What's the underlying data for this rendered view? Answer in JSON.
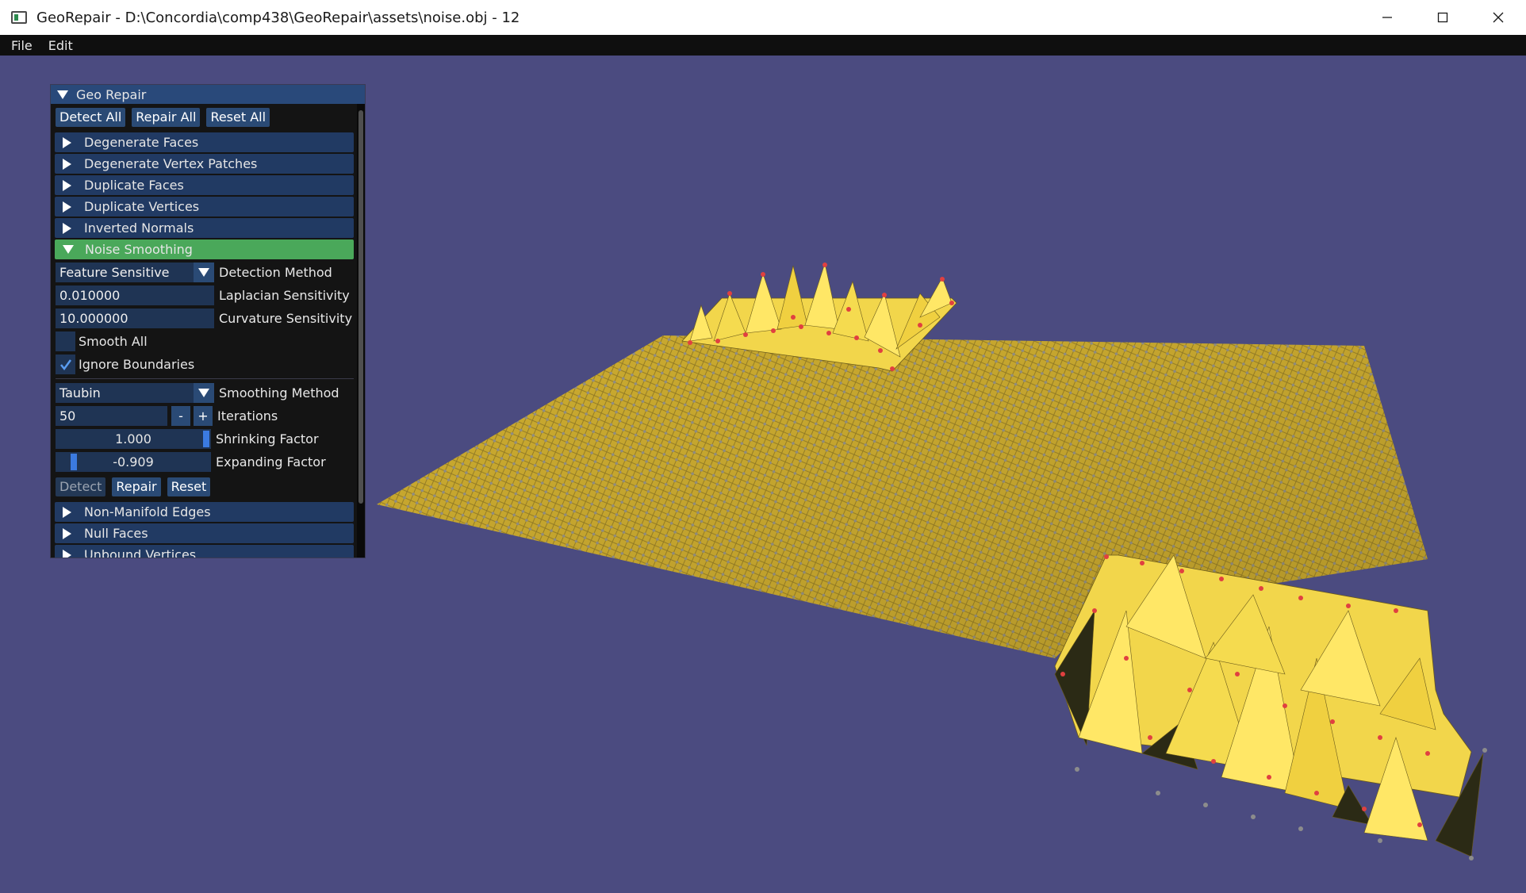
{
  "window": {
    "title": "GeoRepair - D:\\Concordia\\comp438\\GeoRepair\\assets\\noise.obj - 12",
    "controls": [
      "minimize-icon",
      "maximize-icon",
      "close-icon"
    ]
  },
  "menu": {
    "file": "File",
    "edit": "Edit"
  },
  "panel": {
    "title": "Geo Repair",
    "buttons": {
      "detect_all": "Detect All",
      "repair_all": "Repair All",
      "reset_all": "Reset All"
    },
    "sections": [
      "Degenerate Faces",
      "Degenerate Vertex Patches",
      "Duplicate Faces",
      "Duplicate Vertices",
      "Inverted Normals",
      "Noise Smoothing",
      "Non-Manifold Edges",
      "Null Faces",
      "Unbound Vertices"
    ],
    "noise_smoothing": {
      "detection_method_value": "Feature Sensitive",
      "detection_method_label": "Detection Method",
      "laplacian_value": "0.010000",
      "laplacian_label": "Laplacian Sensitivity",
      "curvature_value": "10.000000",
      "curvature_label": "Curvature Sensitivity",
      "smooth_all_label": "Smooth All",
      "smooth_all_checked": false,
      "ignore_boundaries_label": "Ignore Boundaries",
      "ignore_boundaries_checked": true,
      "smoothing_method_value": "Taubin",
      "smoothing_method_label": "Smoothing Method",
      "iterations_value": "50",
      "iterations_label": "Iterations",
      "minus": "-",
      "plus": "+",
      "shrinking_value": "1.000",
      "shrinking_label": "Shrinking Factor",
      "shrinking_fraction": 1.0,
      "expanding_value": "-0.909",
      "expanding_label": "Expanding Factor",
      "expanding_fraction": 0.09,
      "detect": "Detect",
      "repair": "Repair",
      "reset": "Reset"
    }
  },
  "colors": {
    "viewport_bg": "#4b4b80",
    "mesh_yellow": "#f2d64b",
    "mesh_dark": "#2b2a15",
    "vertex_gray": "#8c8c8c",
    "vertex_red": "#e04040",
    "active_section": "#4aa85a"
  }
}
